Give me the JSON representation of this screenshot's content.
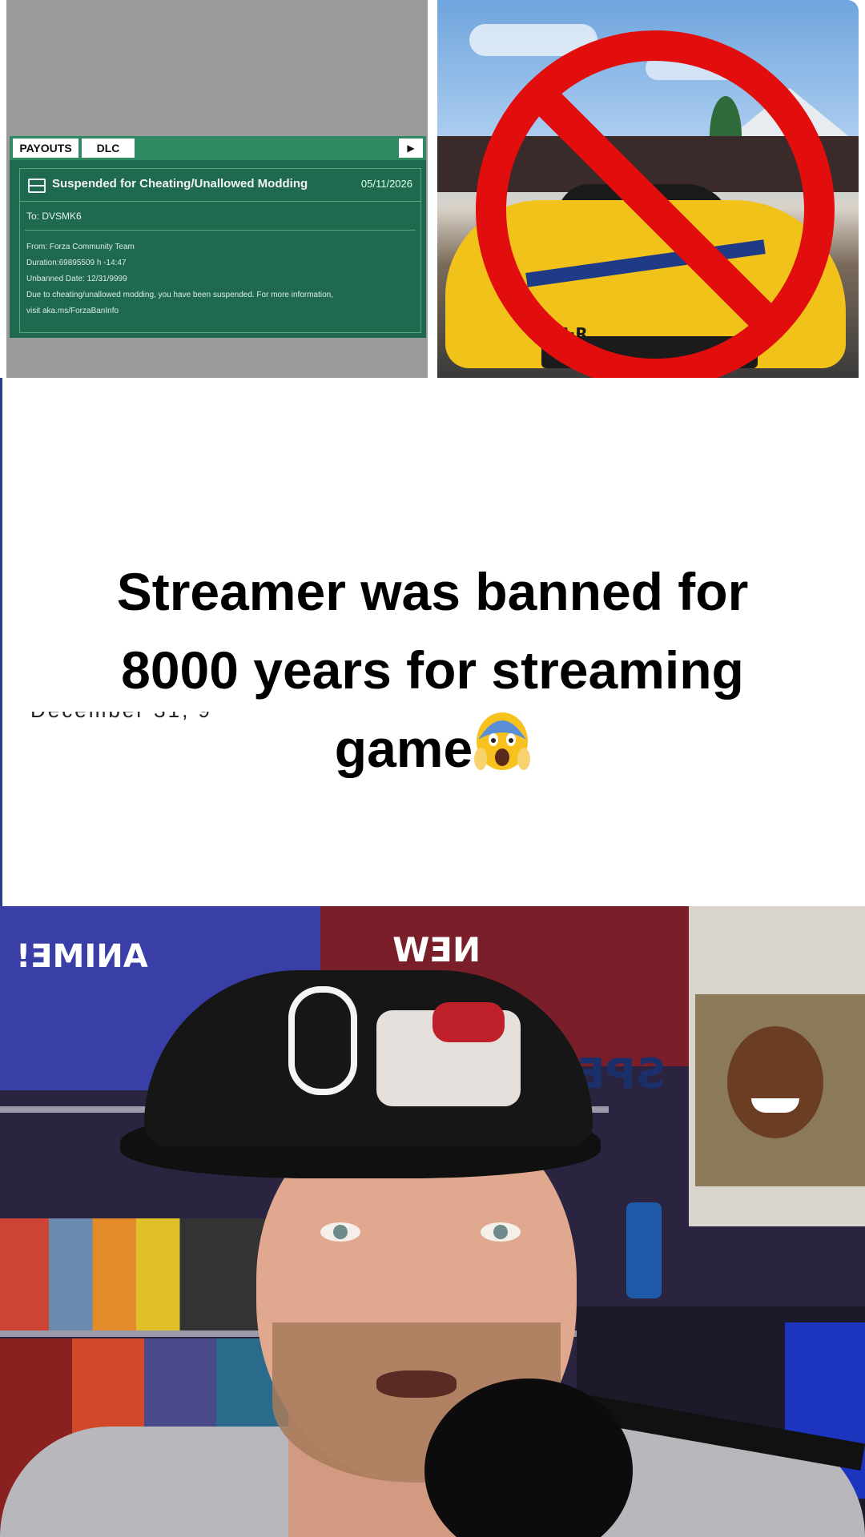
{
  "ban_notice": {
    "tabs": [
      "PAYOUTS",
      "DLC"
    ],
    "play_symbol": "▶",
    "title": "Suspended for Cheating/Unallowed Modding",
    "date": "05/11/2026",
    "to": "To: DVSMK6",
    "from": "From: Forza Community Team",
    "duration": "Duration:69895509 h -14:47",
    "unbanned_date": "Unbanned Date: 12/31/9999",
    "message": "Due to cheating/unallowed modding, you have been suspended. For more information,",
    "link": "visit aka.ms/ForzaBanInfo"
  },
  "game_image": {
    "car_logo": "RS·R",
    "sign_color": "#e20d0d"
  },
  "caption": {
    "line1": "Streamer was banned for",
    "line2": "8000 years for streaming",
    "line3": "game",
    "emoji": "shocked-face-emoji"
  },
  "partial_text": "December 31, 9",
  "video_frame": {
    "poster_left_text": "ANIME!",
    "poster_center_text": "NEW",
    "poster_right_text": "SPE"
  },
  "colors": {
    "ban_card": "#1f6a4e",
    "caption_text": "#000000",
    "accent_line": "#2a3d8f"
  }
}
